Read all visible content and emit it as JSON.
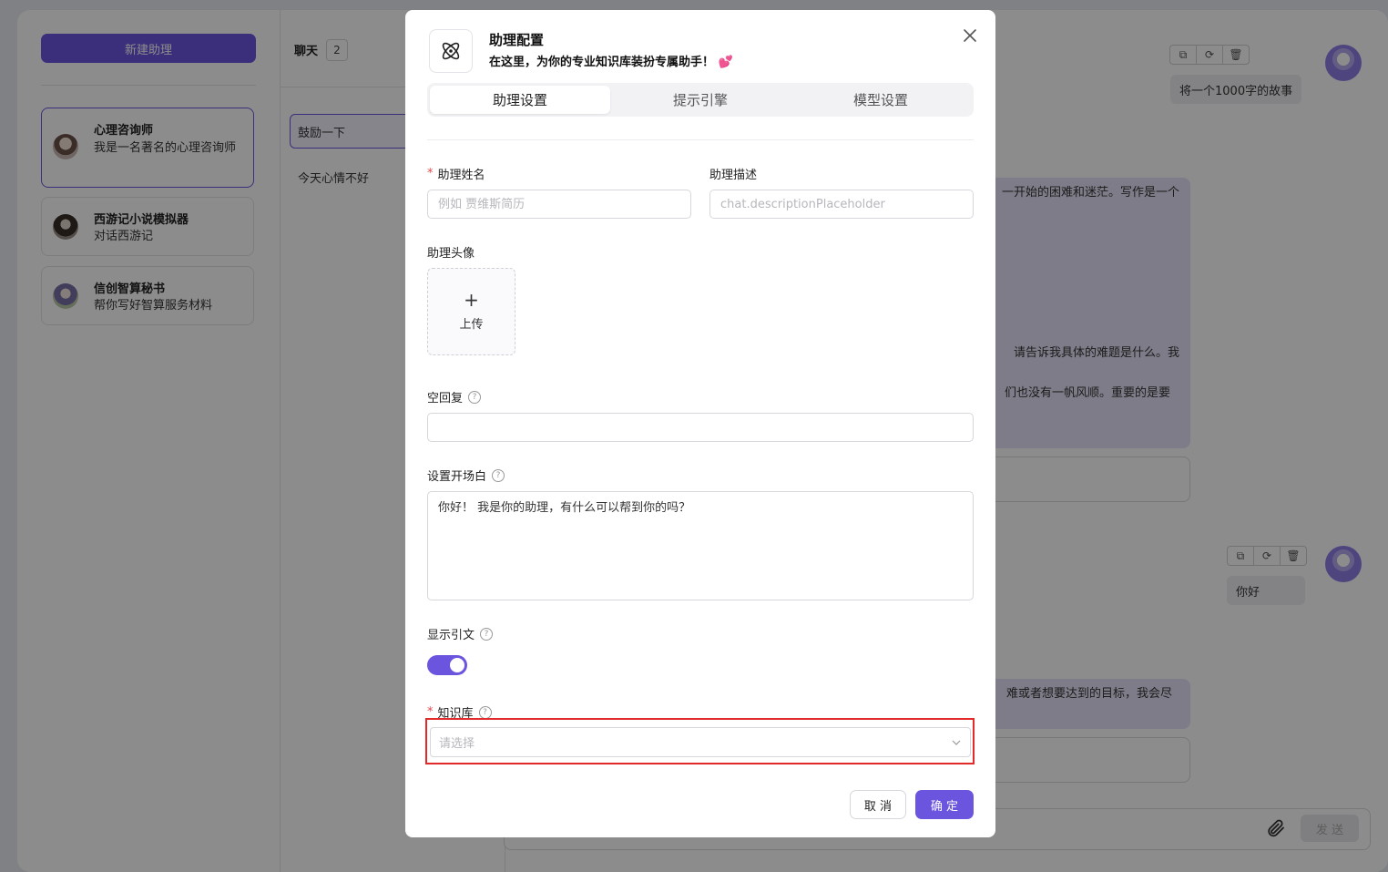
{
  "sidebar": {
    "new_button": "新建助理",
    "assistants": [
      {
        "name": "心理咨询师",
        "desc": "我是一名著名的心理咨询师"
      },
      {
        "name": "西游记小说模拟器",
        "desc": "对话西游记"
      },
      {
        "name": "信创智算秘书",
        "desc": "帮你写好智算服务材料"
      }
    ]
  },
  "chats": {
    "header": "聊天",
    "count": "2",
    "items": [
      "鼓励一下",
      "今天心情不好"
    ]
  },
  "chat_area": {
    "messages": [
      {
        "user": "将一个1000字的故事",
        "bot_lines": [
          "一开始的困难和迷茫。写作是一个",
          "请告诉我具体的难题是什么。我",
          "们也没有一帆风顺。重要的是要"
        ]
      },
      {
        "user": "你好",
        "bot_lines": [
          "难或者想要达到的目标，我会尽"
        ]
      }
    ],
    "send_label": "发 送",
    "tool_icons": [
      "copy-icon",
      "refresh-icon",
      "delete-icon"
    ]
  },
  "modal": {
    "title": "助理配置",
    "subtitle": "在这里，为你的专业知识库装扮专属助手！ 💕",
    "tabs": [
      "助理设置",
      "提示引擎",
      "模型设置"
    ],
    "active_tab": "助理设置",
    "name_label": "助理姓名",
    "name_placeholder": "例如 贾维斯简历",
    "desc_label": "助理描述",
    "desc_placeholder": "chat.descriptionPlaceholder",
    "avatar_label": "助理头像",
    "upload_label": "上传",
    "empty_reply_label": "空回复",
    "empty_reply_value": "",
    "opening_label": "设置开场白",
    "opening_value": "你好！ 我是你的助理，有什么可以帮到你的吗？",
    "show_citation_label": "显示引文",
    "show_citation_on": true,
    "kb_label": "知识库",
    "kb_placeholder": "请选择",
    "cancel_label": "取 消",
    "ok_label": "确 定"
  },
  "colors": {
    "accent": "#6c55de",
    "highlight": "#e22a2a",
    "bot_bubble": "#e6e2f7"
  }
}
